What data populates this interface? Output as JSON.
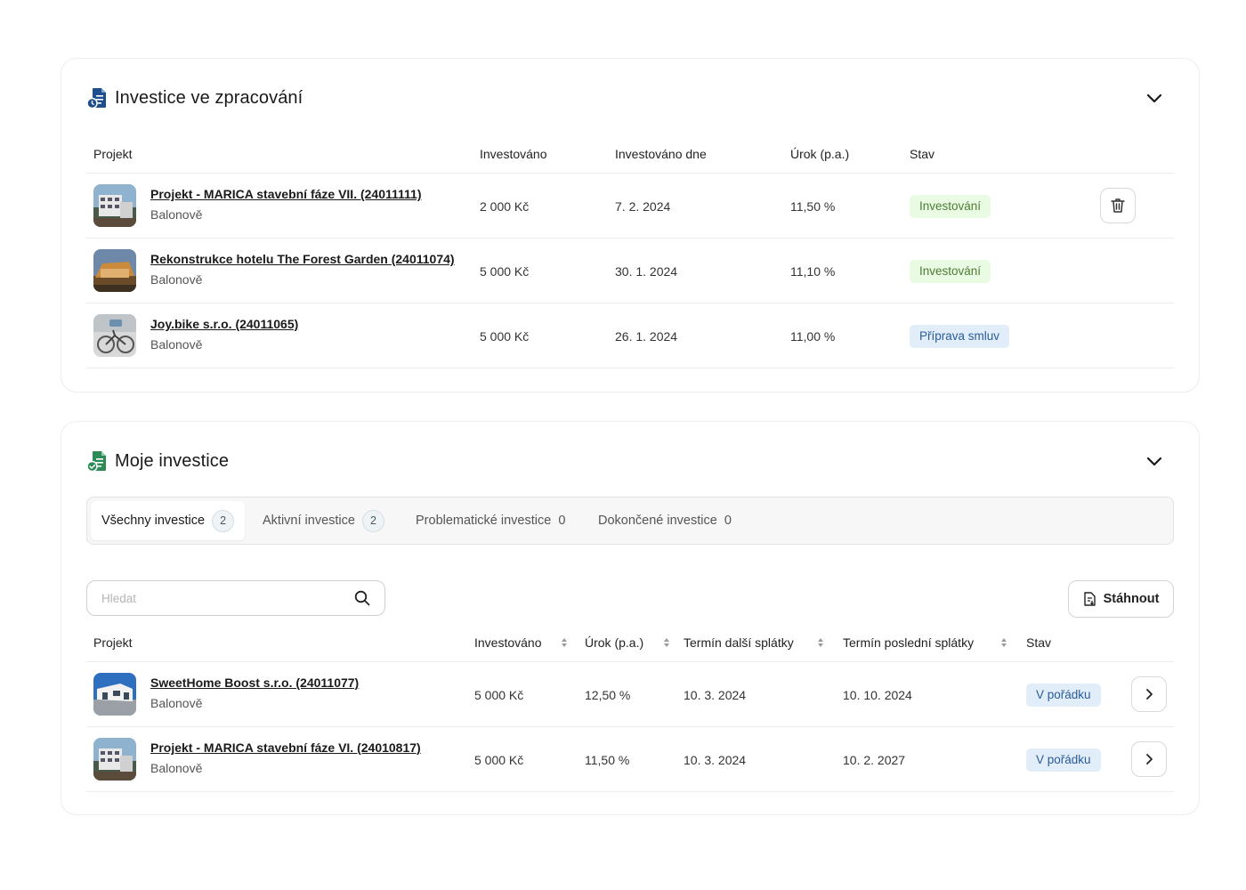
{
  "processing": {
    "title": "Investice ve zpracování",
    "columns": [
      "Projekt",
      "Investováno",
      "Investováno dne",
      "Úrok (p.a.)",
      "Stav"
    ],
    "rows": [
      {
        "name": "Projekt - MARICA stavební fáze VII. (24011111)",
        "type": "Balonově",
        "amount": "2 000 Kč",
        "date": "7. 2. 2024",
        "rate": "11,50 %",
        "status": "Investování",
        "status_color": "#eafbe3"
      },
      {
        "name": "Rekonstrukce hotelu The Forest Garden (24011074)",
        "type": "Balonově",
        "amount": "5 000 Kč",
        "date": "30. 1. 2024",
        "rate": "11,10 %",
        "status": "Investování",
        "status_color": "#eafbe3"
      },
      {
        "name": "Joy.bike s.r.o. (24011065)",
        "type": "Balonově",
        "amount": "5 000 Kč",
        "date": "26. 1. 2024",
        "rate": "11,00 %",
        "status": "Příprava smluv",
        "status_color": "#e1eef9"
      }
    ]
  },
  "my": {
    "title": "Moje investice",
    "tabs": [
      {
        "label": "Všechny investice",
        "count": "2"
      },
      {
        "label": "Aktivní investice",
        "count": "2"
      },
      {
        "label": "Problematické investice",
        "count": "0"
      },
      {
        "label": "Dokončené investice",
        "count": "0"
      }
    ],
    "search_placeholder": "Hledat",
    "download_label": "Stáhnout",
    "columns": [
      "Projekt",
      "Investováno",
      "Úrok (p.a.)",
      "Termín další splátky",
      "Termín poslední splátky",
      "Stav"
    ],
    "rows": [
      {
        "name": "SweetHome Boost s.r.o. (24011077)",
        "type": "Balonově",
        "amount": "5 000 Kč",
        "rate": "12,50 %",
        "next": "10. 3. 2024",
        "last": "10. 10. 2024",
        "status": "V pořádku"
      },
      {
        "name": "Projekt - MARICA stavební fáze VI. (24010817)",
        "type": "Balonově",
        "amount": "5 000 Kč",
        "rate": "11,50 %",
        "next": "10. 3. 2024",
        "last": "10. 2. 2027",
        "status": "V pořádku"
      }
    ]
  },
  "colors": {
    "brand_blue": "#1f4e8c",
    "brand_green": "#2e8b57"
  }
}
